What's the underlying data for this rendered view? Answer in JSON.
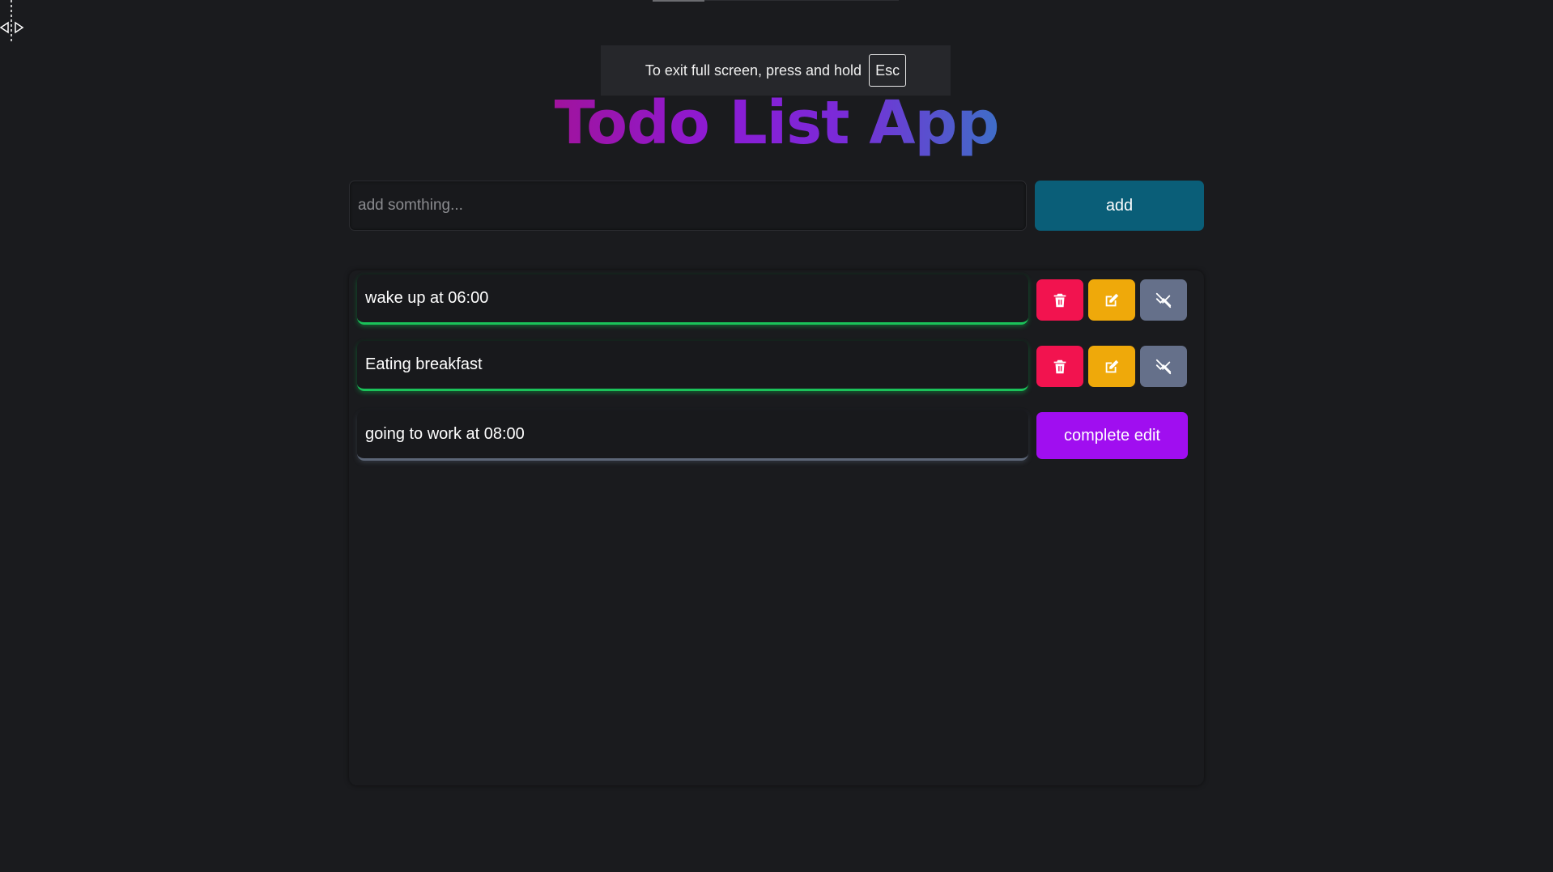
{
  "fullscreen_notice": {
    "message": "To exit full screen, press and hold",
    "key": "Esc"
  },
  "header": {
    "title": "Todo List App"
  },
  "add_form": {
    "placeholder": "add somthing...",
    "value": "",
    "button_label": "add"
  },
  "todos": [
    {
      "text": "wake up at 06:00",
      "status": "done",
      "actions": [
        "trash-icon",
        "edit-icon",
        "undo-icon"
      ]
    },
    {
      "text": "Eating breakfast",
      "status": "done",
      "actions": [
        "trash-icon",
        "edit-icon",
        "undo-icon"
      ]
    },
    {
      "text": "going to work at 08:00",
      "status": "editing",
      "actions": []
    }
  ],
  "edit_actions": {
    "complete_label": "complete edit"
  },
  "colors": {
    "background": "#1a1b1e",
    "add_button": "#0a5e78",
    "delete": "#f2134f",
    "edit": "#efa90a",
    "toggle": "#65708a",
    "complete_edit": "#a00ef0",
    "done_border": "#1bc25a",
    "editing_border": "#5c6677"
  }
}
